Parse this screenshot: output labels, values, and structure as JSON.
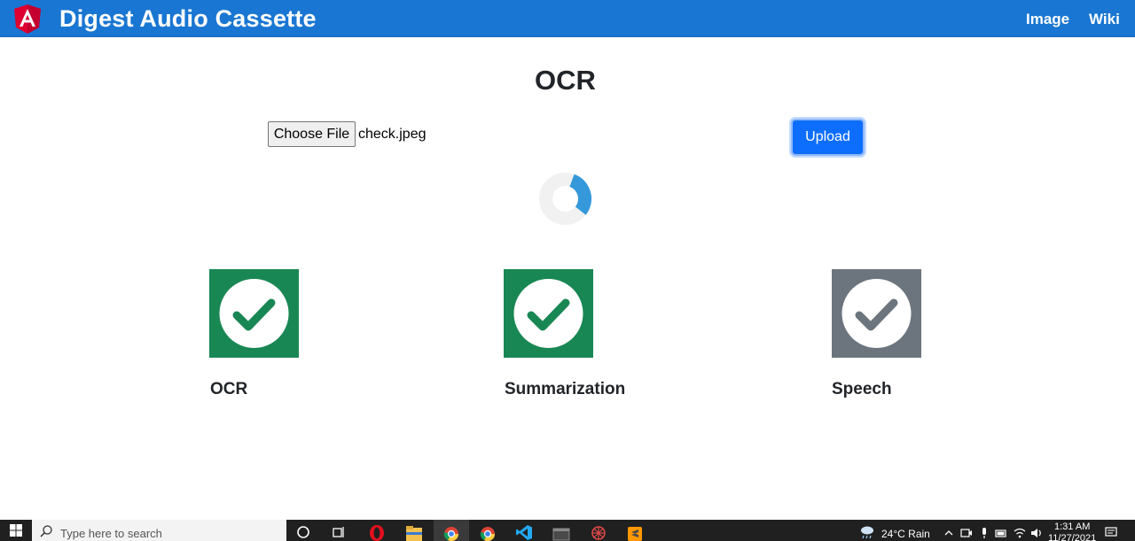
{
  "navbar": {
    "title": "Digest Audio Cassette",
    "links": [
      "Image",
      "Wiki"
    ]
  },
  "main": {
    "heading": "OCR",
    "file_input": {
      "button_label": "Choose File",
      "file_name": "check.jpeg"
    },
    "upload_label": "Upload",
    "steps": [
      {
        "label": "OCR",
        "status": "done",
        "color": "#198754"
      },
      {
        "label": "Summarization",
        "status": "done",
        "color": "#198754"
      },
      {
        "label": "Speech",
        "status": "pending",
        "color": "#6c757d"
      }
    ],
    "spinner_progress": 0.3
  },
  "taskbar": {
    "search_placeholder": "Type here to search",
    "weather": "24°C  Rain",
    "time": "1:31 AM",
    "date": "11/27/2021"
  },
  "colors": {
    "navbar": "#1976d2",
    "primary": "#0d6efd",
    "success": "#198754",
    "secondary": "#6c757d",
    "spinner": "#3498db"
  }
}
